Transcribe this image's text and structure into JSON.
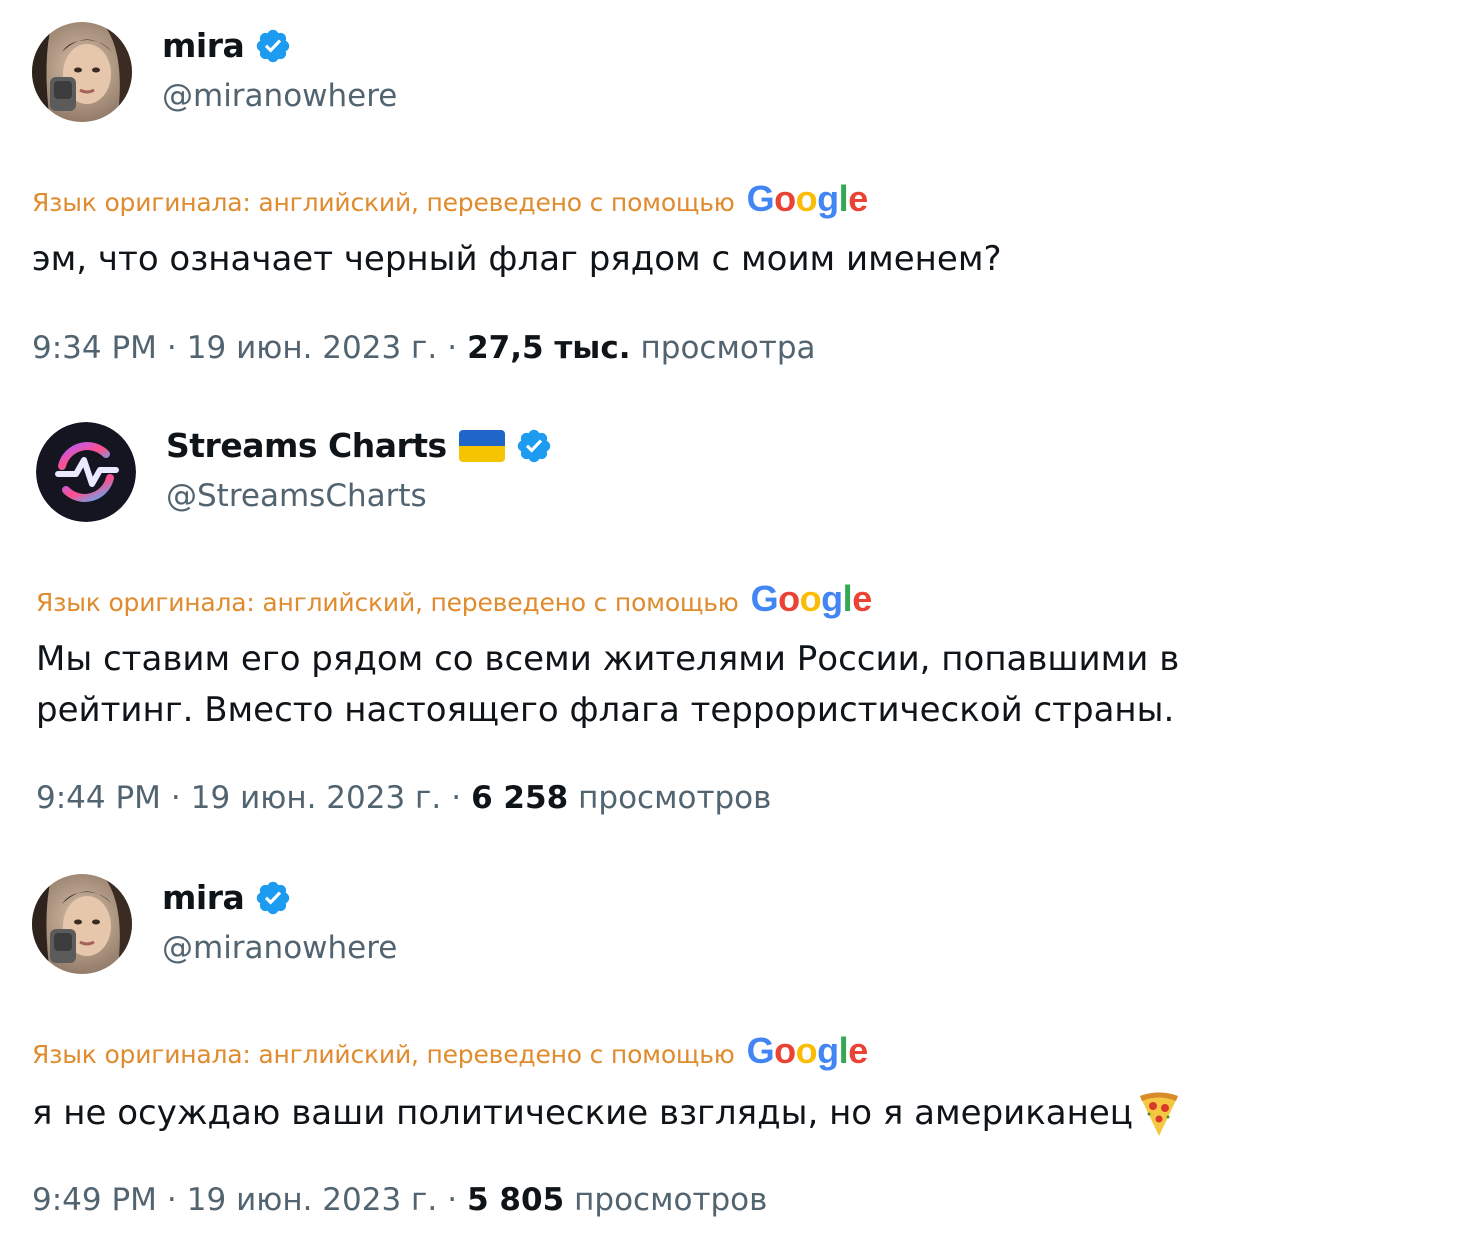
{
  "tweets": [
    {
      "display_name": "mira",
      "handle": "@miranowhere",
      "translate_note": "Язык оригинала: английский, переведено с помощью",
      "google": [
        "G",
        "o",
        "o",
        "g",
        "l",
        "e"
      ],
      "text_lines": [
        "эм, что означает черный флаг рядом с моим именем?"
      ],
      "time": "9:34 PM",
      "date": "19 июн. 2023 г.",
      "separator": "·",
      "views": "27,5 тыс.",
      "views_label": "просмотра"
    },
    {
      "display_name": "Streams Charts",
      "handle": "@StreamsCharts",
      "translate_note": "Язык оригинала: английский, переведено с помощью",
      "google": [
        "G",
        "o",
        "o",
        "g",
        "l",
        "e"
      ],
      "text_lines": [
        "Мы ставим его рядом со всеми жителями России, попавшими в",
        "рейтинг. Вместо настоящего флага террористической страны."
      ],
      "time": "9:44 PM",
      "date": "19 июн. 2023 г.",
      "separator": "·",
      "views": "6 258",
      "views_label": "просмотров"
    },
    {
      "display_name": "mira",
      "handle": "@miranowhere",
      "translate_note": "Язык оригинала: английский, переведено с помощью",
      "google": [
        "G",
        "o",
        "o",
        "g",
        "l",
        "e"
      ],
      "text_lines": [
        "я не осуждаю ваши политические взгляды, но я американец"
      ],
      "time": "9:49 PM",
      "date": "19 июн. 2023 г.",
      "separator": "·",
      "views": "5 805",
      "views_label": "просмотров"
    }
  ],
  "icons": {
    "verified": "verified-badge-icon",
    "flag": "ukraine-flag-icon",
    "pizza": "pizza-icon",
    "streams_logo": "streams-charts-logo"
  },
  "colors": {
    "verified_blue": "#1d9bf0",
    "translate_orange": "#e08b2e",
    "muted_gray": "#536471",
    "text_dark": "#0f1419",
    "google_blue": "#4285f4",
    "google_red": "#ea4335",
    "google_yellow": "#fbbc05",
    "google_green": "#34a853"
  }
}
